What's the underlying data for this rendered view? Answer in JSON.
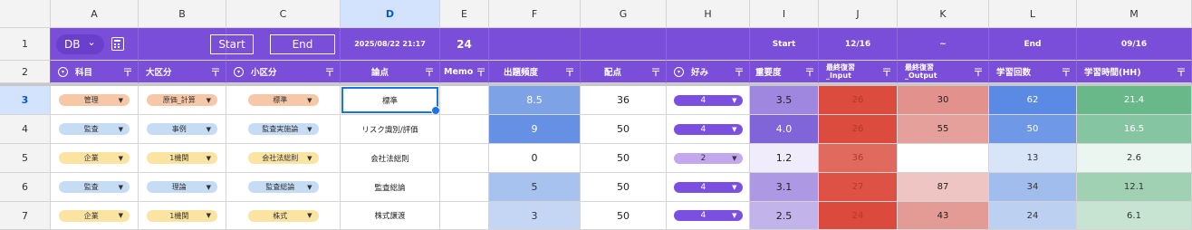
{
  "columns": [
    "A",
    "B",
    "C",
    "D",
    "E",
    "F",
    "G",
    "H",
    "I",
    "J",
    "K",
    "L",
    "M"
  ],
  "selected_column": "D",
  "row_numbers": [
    "1",
    "2",
    "3",
    "4",
    "5",
    "6",
    "7"
  ],
  "selected_row": "3",
  "row1": {
    "db_label": "DB",
    "db_chevron": "⌄",
    "start_button": "Start",
    "end_button": "End",
    "datetime": "2025/08/22 21:17",
    "e1": "24",
    "i1": "Start",
    "j1": "12/16",
    "k1": "~",
    "l1": "End",
    "m1": "09/16"
  },
  "headers": {
    "a": "科目",
    "b": "大区分",
    "c": "小区分",
    "d": "論点",
    "e": "Memo",
    "f": "出題頻度",
    "g": "配点",
    "h": "好み",
    "i": "重要度",
    "j_line1": "最終復習",
    "j_line2": "_Input",
    "k_line1": "最終復習",
    "k_line2": "_Output",
    "l": "学習回数",
    "m": "学習時間(HH)",
    "filter_glyph": "〒"
  },
  "rows": [
    {
      "a": "管理",
      "a_color": "orange",
      "b": "原価_計算",
      "b_color": "orange",
      "c": "標準",
      "c_color": "orange",
      "d": "標準",
      "e": "",
      "f": "8.5",
      "f_bg": "#7da3e6",
      "g": "36",
      "h": "4",
      "h_style": "purple",
      "i": "3.5",
      "i_bg": "#9f86de",
      "j": "26",
      "j_bg": "#dc4c3e",
      "k": "30",
      "k_bg": "#e3918c",
      "l": "62",
      "l_bg": "#5a8ae4",
      "m": "21.4",
      "m_bg": "#69b88a"
    },
    {
      "a": "監査",
      "a_color": "blue",
      "b": "事例",
      "b_color": "blue",
      "c": "監査実施論",
      "c_color": "blue",
      "d": "リスク識別/評価",
      "e": "",
      "f": "9",
      "f_bg": "#6690e3",
      "g": "50",
      "h": "4",
      "h_style": "purple",
      "i": "4.0",
      "i_bg": "#8065d8",
      "j": "26",
      "j_bg": "#dc4c3e",
      "k": "55",
      "k_bg": "#e5a09b",
      "l": "50",
      "l_bg": "#6f99e7",
      "m": "16.5",
      "m_bg": "#86c5a1"
    },
    {
      "a": "企業",
      "a_color": "yellow",
      "b": "1機関",
      "b_color": "yellow",
      "c": "会社法総則",
      "c_color": "yellow",
      "d": "会社法総則",
      "e": "",
      "f": "0",
      "f_bg": "#ffffff",
      "g": "50",
      "h": "2",
      "h_style": "lpurple",
      "i": "1.2",
      "i_bg": "#f1ecfb",
      "j": "36",
      "j_bg": "#e06a5e",
      "k": "",
      "k_bg": "#ffffff",
      "l": "13",
      "l_bg": "#d8e4f8",
      "m": "2.6",
      "m_bg": "#ecf6f0"
    },
    {
      "a": "監査",
      "a_color": "blue",
      "b": "理論",
      "b_color": "blue",
      "c": "監査総論",
      "c_color": "blue",
      "d": "監査総論",
      "e": "",
      "f": "5",
      "f_bg": "#a8c2ef",
      "g": "50",
      "h": "4",
      "h_style": "purple",
      "i": "3.1",
      "i_bg": "#ad98e3",
      "j": "27",
      "j_bg": "#dd5244",
      "k": "87",
      "k_bg": "#eec5c2",
      "l": "34",
      "l_bg": "#a1bdee",
      "m": "12.1",
      "m_bg": "#a0d1b3"
    },
    {
      "a": "企業",
      "a_color": "yellow",
      "b": "1機関",
      "b_color": "yellow",
      "c": "株式",
      "c_color": "yellow",
      "d": "株式譲渡",
      "e": "",
      "f": "3",
      "f_bg": "#c5d6f4",
      "g": "50",
      "h": "4",
      "h_style": "purple",
      "i": "2.5",
      "i_bg": "#c3b3eb",
      "j": "24",
      "j_bg": "#db4a3c",
      "k": "43",
      "k_bg": "#e49a95",
      "l": "24",
      "l_bg": "#bcd0f2",
      "m": "6.1",
      "m_bg": "#c7e4d2"
    }
  ]
}
